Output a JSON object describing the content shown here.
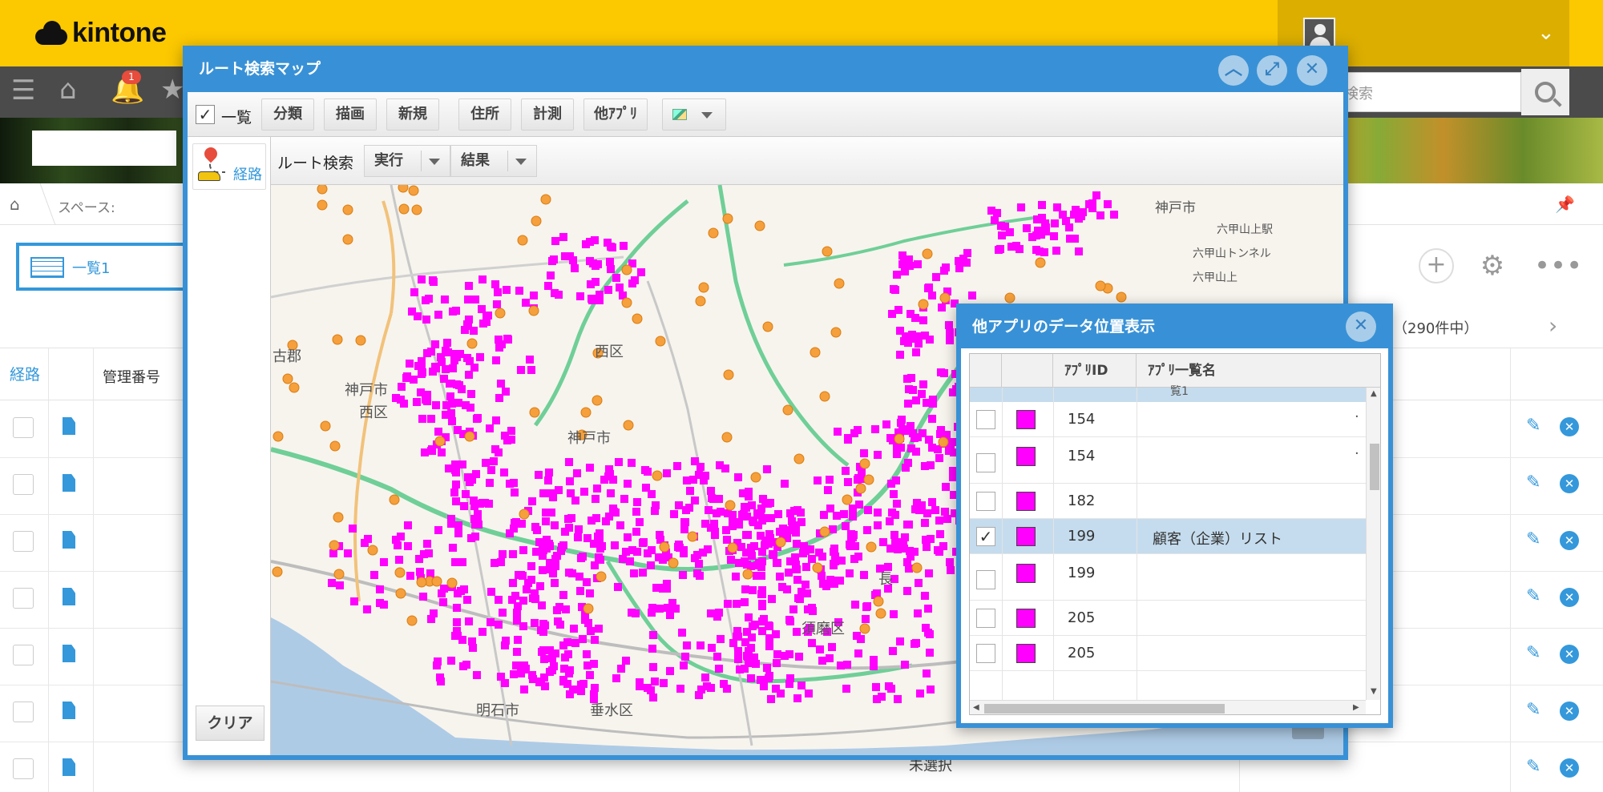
{
  "app": {
    "brand": "kintone",
    "notification_count": "1",
    "search_placeholder": "検索"
  },
  "breadcrumb": {
    "space": "スペース:"
  },
  "view": {
    "name": "一覧1",
    "record_count": "（290件中）"
  },
  "list": {
    "headers": {
      "route": "経路",
      "manage_no": "管理番号"
    },
    "last_row_value": "未選択"
  },
  "map_window": {
    "title": "ルート検索マップ",
    "toolbar": {
      "list_label": "一覧",
      "buttons": [
        "分類",
        "描画",
        "新規",
        "住所",
        "計測",
        "他ｱﾌﾟﾘ"
      ]
    },
    "sidebar": {
      "route_label": "経路",
      "clear_label": "クリア"
    },
    "route_bar": {
      "label": "ルート検索",
      "run_label": "実行",
      "result_label": "結果"
    },
    "map_labels": {
      "kobe_city_ne": "神戸市",
      "rokko_tunnel": "六甲山トンネル",
      "rokko_station": "六甲山上駅",
      "rokkosan_ue": "六甲山上",
      "seishin": "西区",
      "kobe_nishiku_1": "神戸市",
      "kobe_nishiku_2": "西区",
      "kobe_center": "神戸市",
      "sumaku": "須磨区",
      "akashi_city": "明石市",
      "tarumi": "垂水区",
      "kako_gun": "古郡",
      "chojin": "長"
    },
    "marker_colors": {
      "magenta": "#ff00ff",
      "orange": "#f5a03c"
    }
  },
  "other_app_dialog": {
    "title": "他アプリのデータ位置表示",
    "columns": [
      "ｱﾌﾟﾘID",
      "ｱﾌﾟﾘ一覧名"
    ],
    "strip_text": "覧1",
    "rows": [
      {
        "app_id": "154",
        "list_name": "",
        "checked": false,
        "mark": "·"
      },
      {
        "app_id": "154",
        "list_name": "",
        "checked": false,
        "mark": "·"
      },
      {
        "app_id": "182",
        "list_name": "",
        "checked": false,
        "mark": ""
      },
      {
        "app_id": "199",
        "list_name": "顧客（企業）リスト",
        "checked": true,
        "mark": ""
      },
      {
        "app_id": "199",
        "list_name": "",
        "checked": false,
        "mark": ""
      },
      {
        "app_id": "205",
        "list_name": "",
        "checked": false,
        "mark": ""
      },
      {
        "app_id": "205",
        "list_name": "",
        "checked": false,
        "mark": ""
      }
    ]
  }
}
